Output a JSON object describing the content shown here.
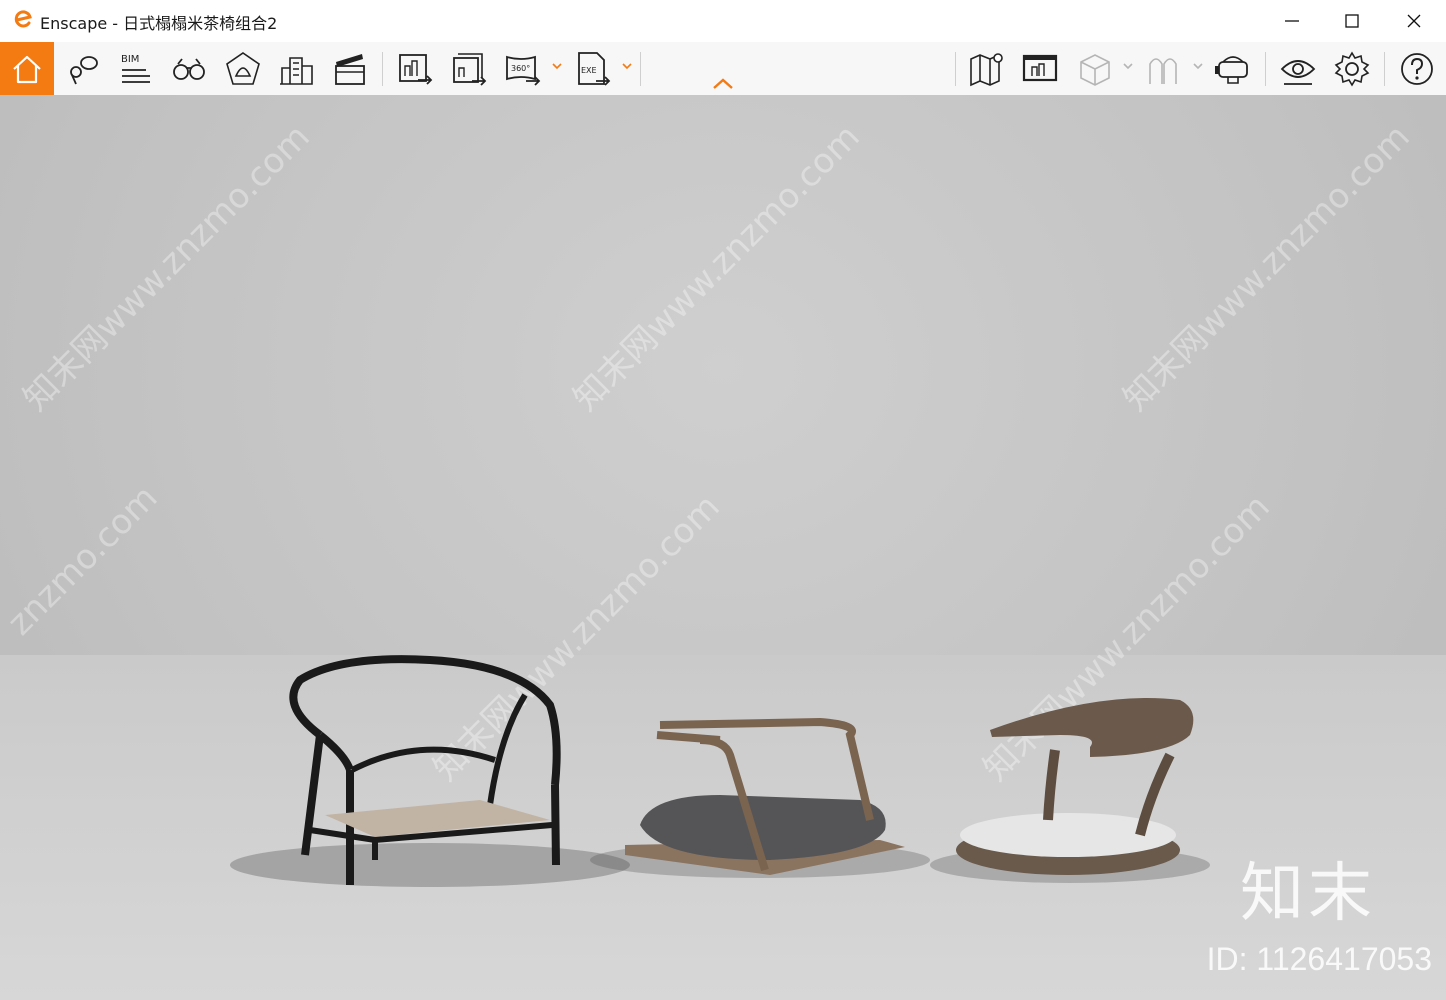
{
  "window": {
    "app_name": "Enscape",
    "title": "Enscape - 日式榻榻米茶椅组合2",
    "minimize_icon": "minimize-icon",
    "maximize_icon": "maximize-icon",
    "close_icon": "close-icon"
  },
  "toolbar": {
    "accent": "#f47a12",
    "left_items": [
      {
        "name": "home-icon",
        "label": ""
      },
      {
        "name": "location-pin-icon",
        "label": ""
      },
      {
        "name": "bim-icon",
        "label": "BIM"
      },
      {
        "name": "binoculars-icon",
        "label": ""
      },
      {
        "name": "bell-icon",
        "label": ""
      },
      {
        "name": "buildings-icon",
        "label": ""
      },
      {
        "name": "clapperboard-icon",
        "label": ""
      },
      {
        "name": "render-screenshot-icon",
        "label": ""
      },
      {
        "name": "batch-render-icon",
        "label": ""
      },
      {
        "name": "panorama-360-icon",
        "label": "360°"
      },
      {
        "name": "export-exe-icon",
        "label": "EXE"
      }
    ],
    "right_items": [
      {
        "name": "map-icon"
      },
      {
        "name": "presentation-icon"
      },
      {
        "name": "cube-icon"
      },
      {
        "name": "people-icon"
      },
      {
        "name": "vr-headset-icon"
      },
      {
        "name": "visual-settings-eye-icon"
      },
      {
        "name": "gear-icon"
      },
      {
        "name": "help-icon"
      }
    ],
    "collapse_icon": "chevron-up-icon"
  },
  "viewport": {
    "watermarks": [
      "知末网www.znzmo.com",
      "知末网www.znzmo.com",
      "知末网www.znzmo.com",
      "znzmo.com",
      "知末网www.znzmo.com",
      "知末网www.znzmo.com"
    ],
    "brand": "知末",
    "id_text": "ID: 1126417053"
  }
}
